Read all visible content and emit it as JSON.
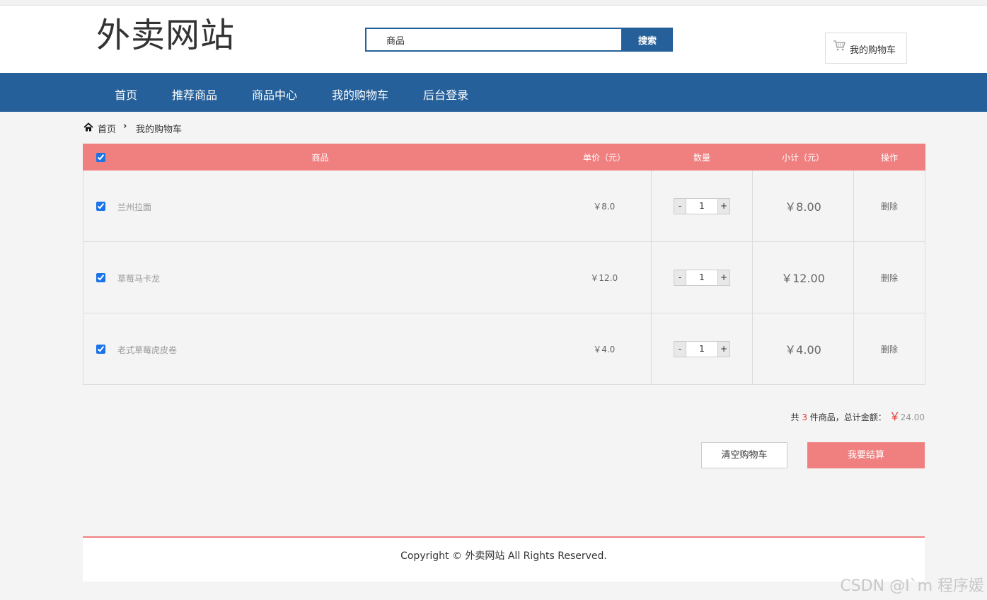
{
  "site": {
    "logo": "外卖网站"
  },
  "search": {
    "value": "商品",
    "button": "搜索"
  },
  "cart_link": {
    "label": "我的购物车",
    "icon": "cart-icon"
  },
  "nav": {
    "items": [
      "首页",
      "推荐商品",
      "商品中心",
      "我的购物车",
      "后台登录"
    ]
  },
  "breadcrumb": {
    "home": "首页",
    "current": "我的购物车"
  },
  "table": {
    "headers": {
      "product": "商品",
      "price": "单价（元）",
      "qty": "数量",
      "subtotal": "小计（元）",
      "action": "操作"
    },
    "rows": [
      {
        "name": "兰州拉面",
        "price": "￥8.0",
        "qty": "1",
        "subtotal": "￥8.00",
        "action": "删除",
        "checked": true
      },
      {
        "name": "草莓马卡龙",
        "price": "￥12.0",
        "qty": "1",
        "subtotal": "￥12.00",
        "action": "删除",
        "checked": true
      },
      {
        "name": "老式草莓虎皮卷",
        "price": "￥4.0",
        "qty": "1",
        "subtotal": "￥4.00",
        "action": "删除",
        "checked": true
      }
    ],
    "minus": "-",
    "plus": "+"
  },
  "summary": {
    "prefix": "共",
    "count": "3",
    "middle": "件商品，总计金额：",
    "yen": "￥",
    "amount": "24.00"
  },
  "actions": {
    "clear": "清空购物车",
    "checkout": "我要结算"
  },
  "footer": {
    "text": "Copyright © 外卖网站 All Rights Reserved."
  },
  "watermark": "CSDN @I`m 程序媛",
  "colors": {
    "primary": "#26609a",
    "accent": "#f08080",
    "price_red": "#e4393c"
  }
}
